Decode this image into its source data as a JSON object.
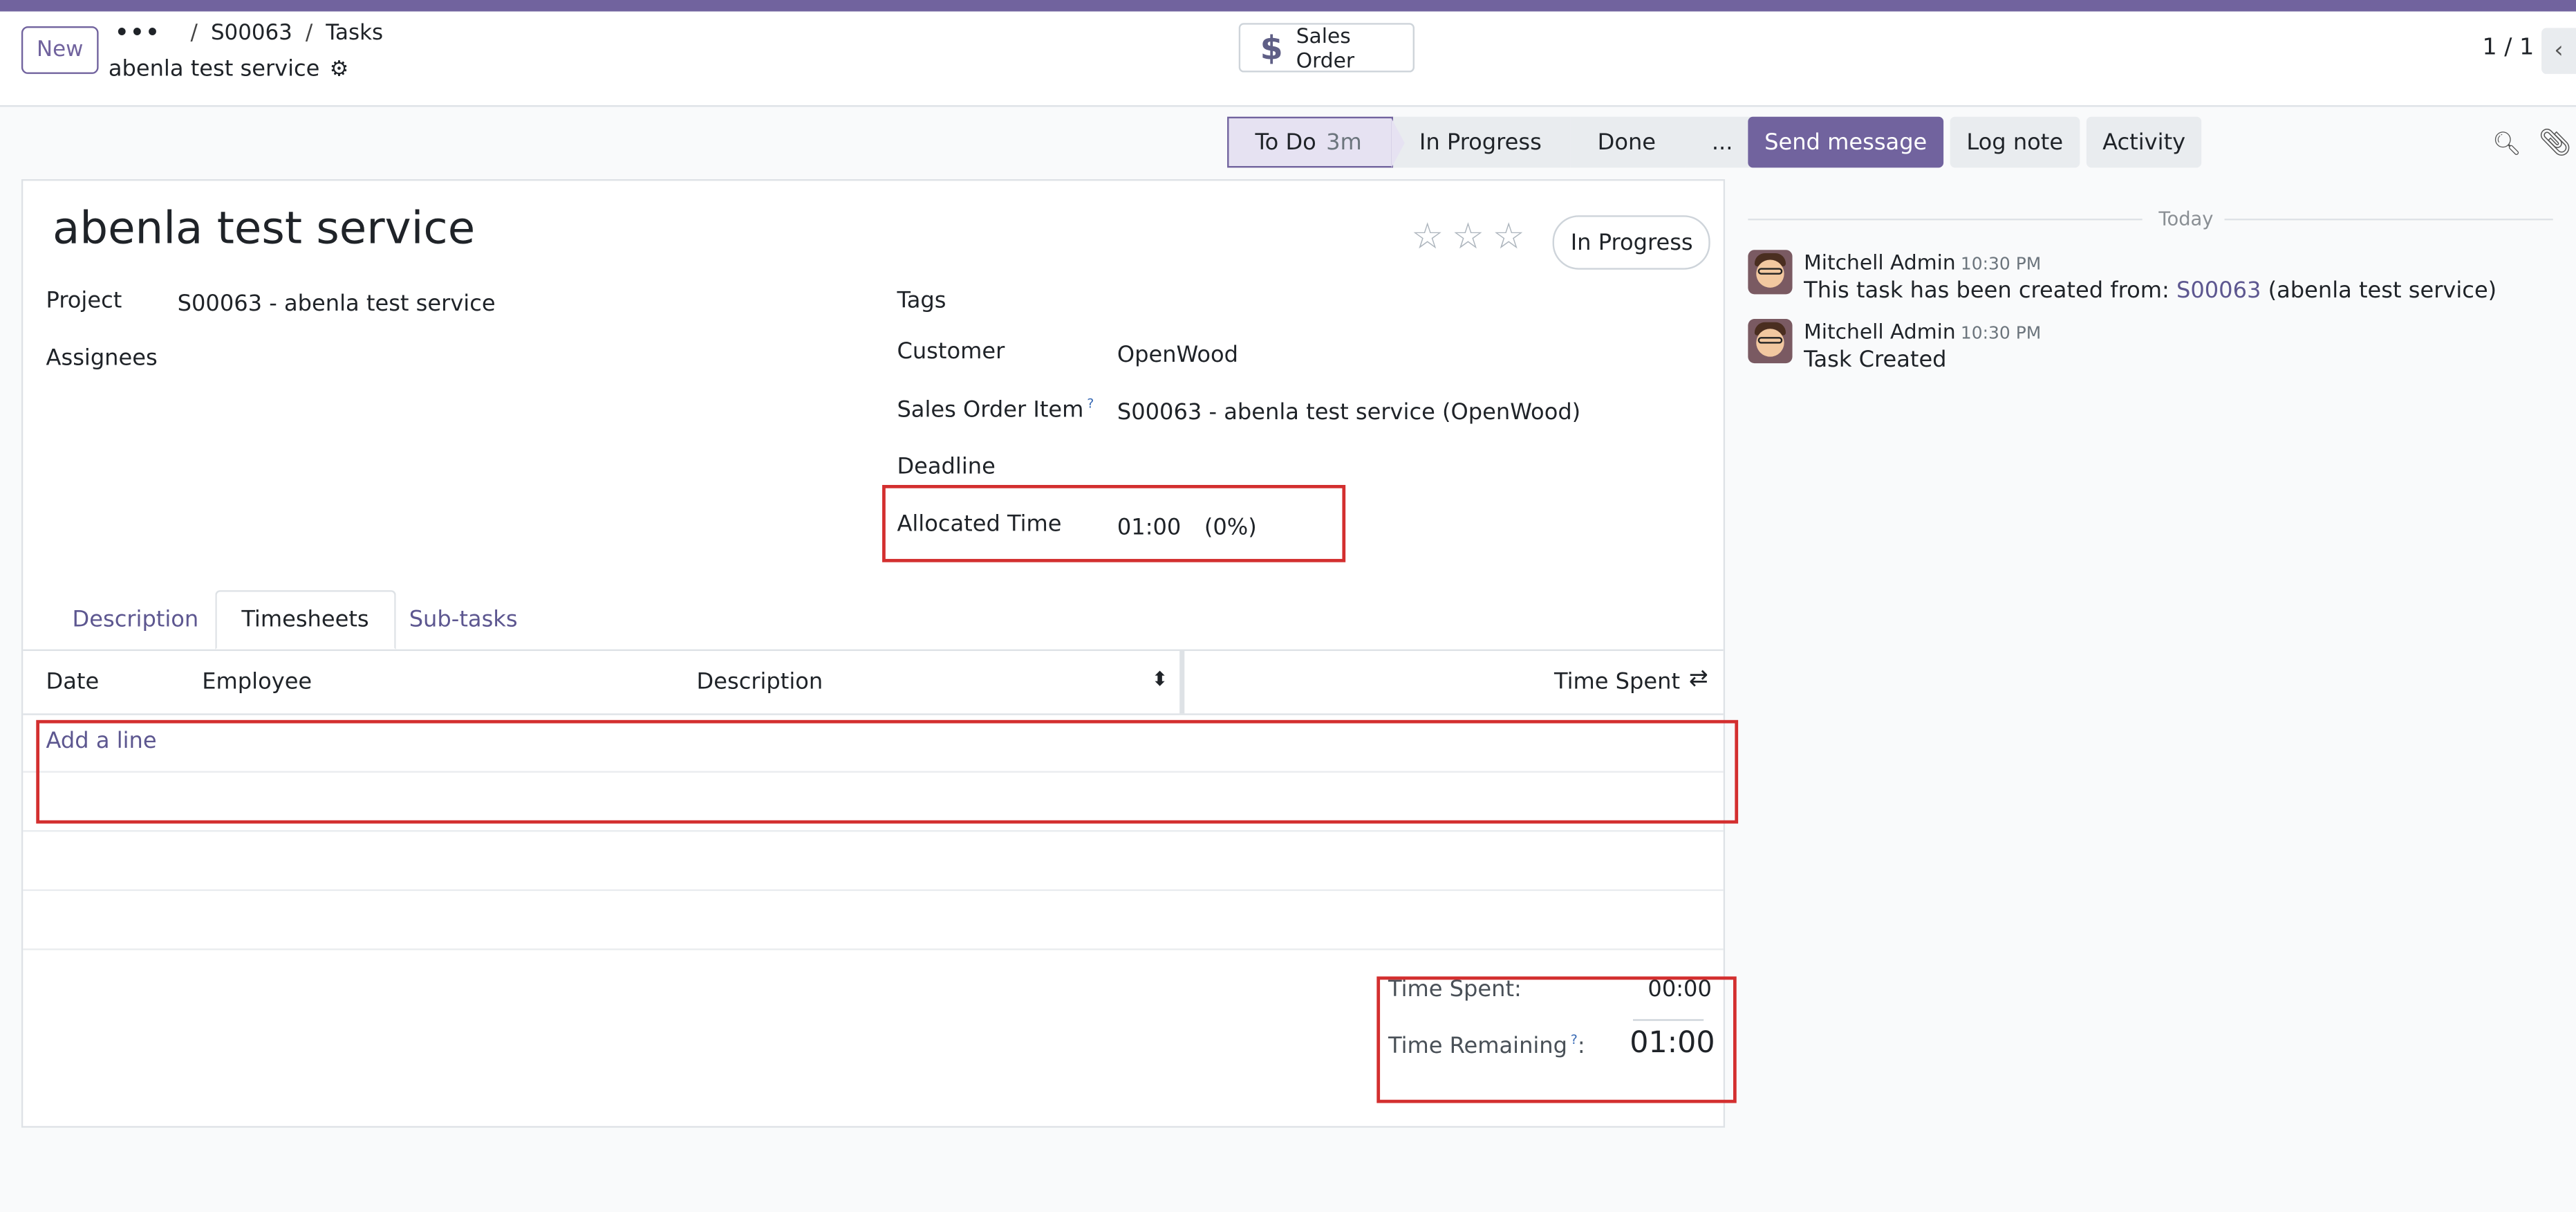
{
  "control_panel": {
    "new_label": "New",
    "breadcrumb": [
      "S00063",
      "Tasks"
    ],
    "record_title": "abenla test service",
    "smart_button": "Sales Order",
    "pager": "1 / 1"
  },
  "statusbar": {
    "stages": [
      {
        "label": "To Do",
        "duration": "3m",
        "active": true
      },
      {
        "label": "In Progress",
        "active": false
      },
      {
        "label": "Done",
        "active": false
      },
      {
        "label": "...",
        "active": false
      }
    ]
  },
  "chatter_buttons": [
    "Send message",
    "Log note",
    "Activity"
  ],
  "form": {
    "title": "abenla test service",
    "state": "In Progress",
    "fields": {
      "project_label": "Project",
      "project_value": "S00063 - abenla test service",
      "assignees_label": "Assignees",
      "tags_label": "Tags",
      "customer_label": "Customer",
      "customer_value": "OpenWood",
      "so_item_label": "Sales Order Item",
      "so_item_help": "?",
      "so_item_value": "S00063 - abenla test service (OpenWood)",
      "deadline_label": "Deadline",
      "allocated_label": "Allocated Time",
      "allocated_value": "01:00",
      "allocated_pct": "(0%)"
    },
    "tabs": [
      "Description",
      "Timesheets",
      "Sub-tasks"
    ],
    "timesheet": {
      "columns": [
        "Date",
        "Employee",
        "Description",
        "Time Spent"
      ],
      "add_line": "Add a line"
    },
    "totals": {
      "spent_label": "Time Spent:",
      "spent_value": "00:00",
      "remaining_label": "Time Remaining",
      "remaining_help": "?",
      "remaining_colon": ":",
      "remaining_value": "01:00"
    }
  },
  "chatter": {
    "date_separator": "Today",
    "messages": [
      {
        "author": "Mitchell Admin",
        "time": "10:30 PM",
        "text_before": "This task has been created from: ",
        "link": "S00063",
        "text_after": " (abenla test service)"
      },
      {
        "author": "Mitchell Admin",
        "time": "10:30 PM",
        "text_before": "Task Created",
        "link": "",
        "text_after": ""
      }
    ]
  }
}
